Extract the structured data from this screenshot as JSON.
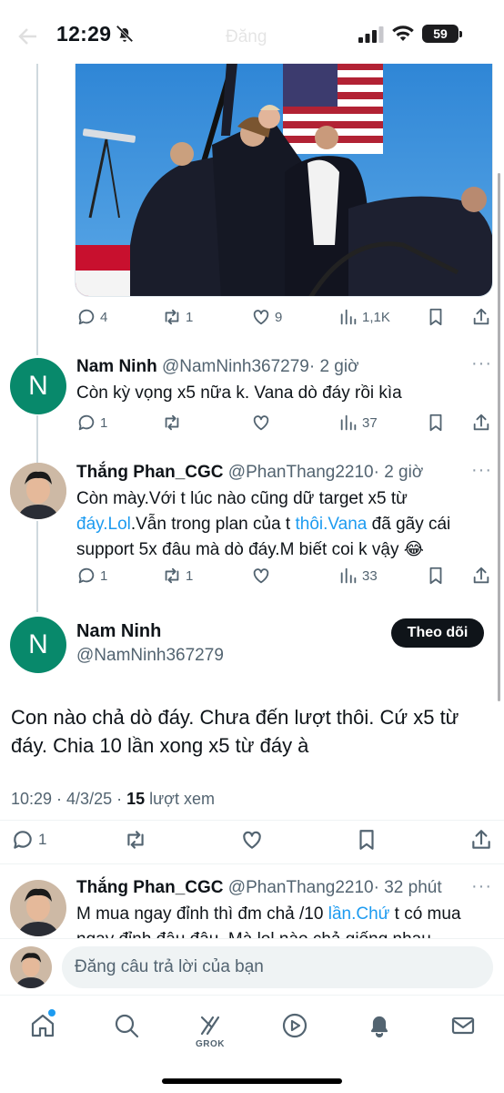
{
  "status_bar": {
    "time": "12:29",
    "battery": "59",
    "header_title_ghost": "Đăng"
  },
  "top_tweet_actions": {
    "replies": "4",
    "reposts": "1",
    "likes": "9",
    "views": "1,1K"
  },
  "replies": [
    {
      "name": "Nam Ninh",
      "handle": "@NamNinh367279",
      "time": "· 2 giờ",
      "avatar_letter": "N",
      "text": "Còn kỳ vọng x5 nữa k. Vana dò đáy rồi kìa",
      "stats": {
        "replies": "1",
        "reposts": "",
        "likes": "",
        "views": "37"
      }
    },
    {
      "name": "Thắng Phan_CGC",
      "handle": "@PhanThang2210",
      "time": "· 2 giờ",
      "text_parts": {
        "a": "Còn mày.Với t lúc nào cũng dữ target x5 từ ",
        "link1": "đáy.Lol",
        "b": ".Vẫn trong plan của t ",
        "link2": "thôi.Vana",
        "c": " đã gãy cái support 5x đâu mà dò đáy.M biết coi k vậy 😂"
      },
      "stats": {
        "replies": "1",
        "reposts": "1",
        "likes": "",
        "views": "33"
      }
    }
  ],
  "main_tweet": {
    "name": "Nam Ninh",
    "handle": "@NamNinh367279",
    "avatar_letter": "N",
    "follow_label": "Theo dõi",
    "text": "Con nào chả dò đáy. Chưa đến lượt thôi. Cứ x5 từ đáy. Chia 10 lần xong x5 từ đáy à",
    "timestamp": "10:29 · 4/3/25 · ",
    "views_count": "15",
    "views_label": " lượt xem",
    "replies": "1"
  },
  "next_reply": {
    "name": "Thắng Phan_CGC",
    "handle": "@PhanThang2210",
    "time": "· 32 phút",
    "text_a": "M mua ngay đỉnh thì đm chả /10 ",
    "link": "lần.Chứ",
    "text_b": " t có mua",
    "text_line2": "ngay đỉnh đâu đâu. Mà lol nào chả giống nhau"
  },
  "composer": {
    "placeholder": "Đăng câu trả lời của bạn"
  },
  "tabbar": {
    "grok_label": "GROK"
  },
  "colors": {
    "link": "#1d9bf0",
    "avatar_n": "#08896b",
    "text": "#0f1419",
    "muted": "#536471"
  }
}
